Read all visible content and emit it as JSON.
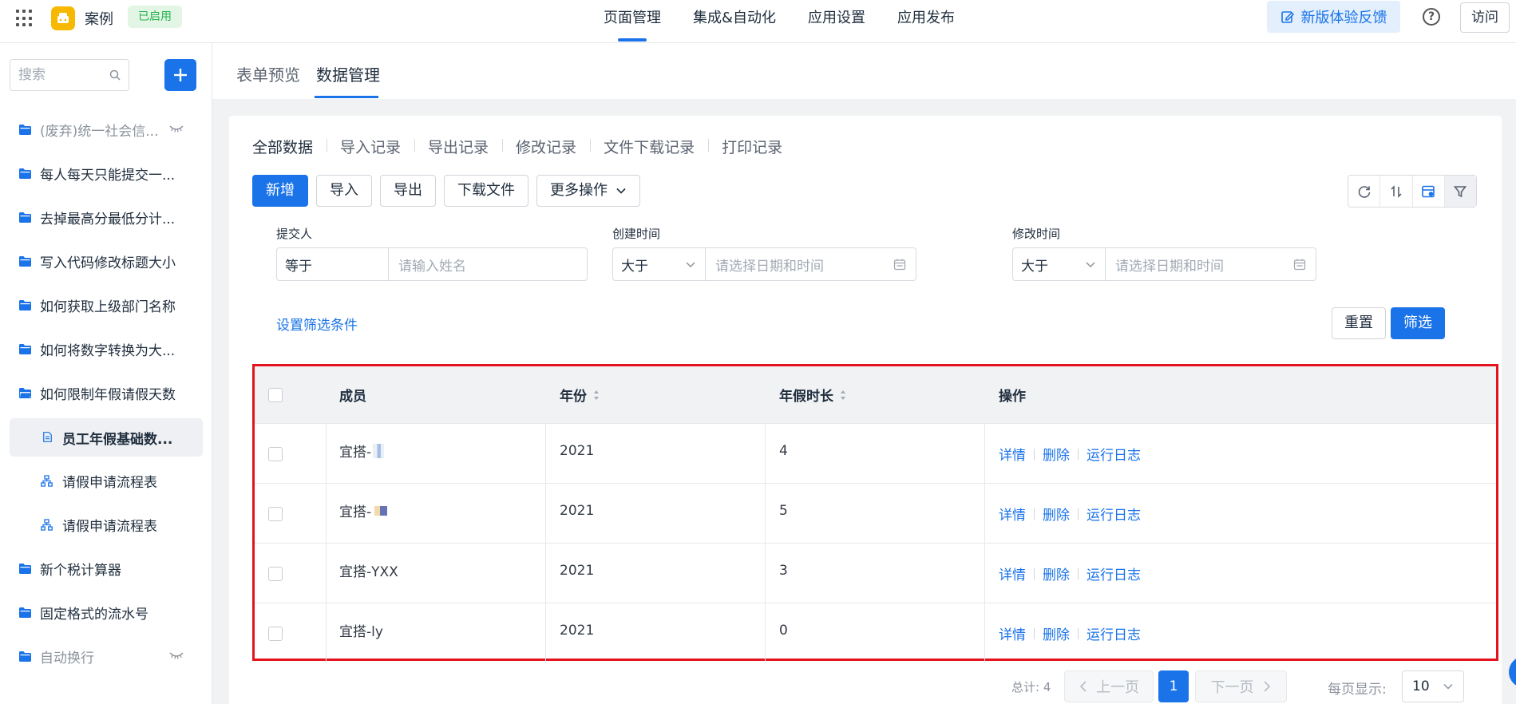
{
  "header": {
    "app_name": "案例",
    "app_status": "已启用",
    "nav": [
      "页面管理",
      "集成&自动化",
      "应用设置",
      "应用发布"
    ],
    "feedback_label": "新版体验反馈",
    "help_label": "?",
    "visit_label": "访问"
  },
  "sidebar": {
    "search_placeholder": "搜索",
    "items": [
      {
        "label": "(废弃)统一社会信...",
        "icon": "folder-icon",
        "hidden": true
      },
      {
        "label": "每人每天只能提交一...",
        "icon": "folder-icon"
      },
      {
        "label": "去掉最高分最低分计...",
        "icon": "folder-icon"
      },
      {
        "label": "写入代码修改标题大小",
        "icon": "folder-icon"
      },
      {
        "label": "如何获取上级部门名称",
        "icon": "folder-icon"
      },
      {
        "label": "如何将数字转换为大...",
        "icon": "folder-icon"
      },
      {
        "label": "如何限制年假请假天数",
        "icon": "folder-open-icon"
      },
      {
        "label": "员工年假基础数...",
        "icon": "form-icon",
        "selected": true
      },
      {
        "label": "请假申请流程表",
        "icon": "flow-icon"
      },
      {
        "label": "请假申请流程表",
        "icon": "flow-icon"
      },
      {
        "label": "新个税计算器",
        "icon": "folder-icon"
      },
      {
        "label": "固定格式的流水号",
        "icon": "folder-icon"
      },
      {
        "label": "自动换行",
        "icon": "folder-icon",
        "hidden": true
      }
    ]
  },
  "main": {
    "tabs": [
      "表单预览",
      "数据管理"
    ],
    "sub_tabs": [
      "全部数据",
      "导入记录",
      "导出记录",
      "修改记录",
      "文件下载记录",
      "打印记录"
    ],
    "toolbar": {
      "add": "新增",
      "import": "导入",
      "export": "导出",
      "download": "下载文件",
      "more": "更多操作"
    },
    "filters": [
      {
        "label": "提交人",
        "operator": "等于",
        "placeholder": "请输入姓名"
      },
      {
        "label": "创建时间",
        "operator": "大于",
        "placeholder": "请选择日期和时间"
      },
      {
        "label": "修改时间",
        "operator": "大于",
        "placeholder": "请选择日期和时间"
      }
    ],
    "set_condition": "设置筛选条件",
    "reset": "重置",
    "filter": "筛选",
    "table": {
      "columns": [
        "成员",
        "年份",
        "年假时长",
        "操作"
      ],
      "rows": [
        {
          "member": "宜搭-",
          "year": "2021",
          "days": "4"
        },
        {
          "member": "宜搭-",
          "year": "2021",
          "days": "5"
        },
        {
          "member": "宜搭-YXX",
          "year": "2021",
          "days": "3"
        },
        {
          "member": "宜搭-ly",
          "year": "2021",
          "days": "0"
        }
      ],
      "actions": [
        "详情",
        "删除",
        "运行日志"
      ]
    },
    "pagination": {
      "total": "总计: 4",
      "prev": "上一页",
      "page": "1",
      "next": "下一页",
      "page_size_label": "每页显示:",
      "page_size": "10"
    }
  },
  "colors": {
    "primary": "#1a73e8",
    "highlight_border": "#e3141e",
    "status_green": "#22b14c",
    "logo": "#f7b900"
  }
}
